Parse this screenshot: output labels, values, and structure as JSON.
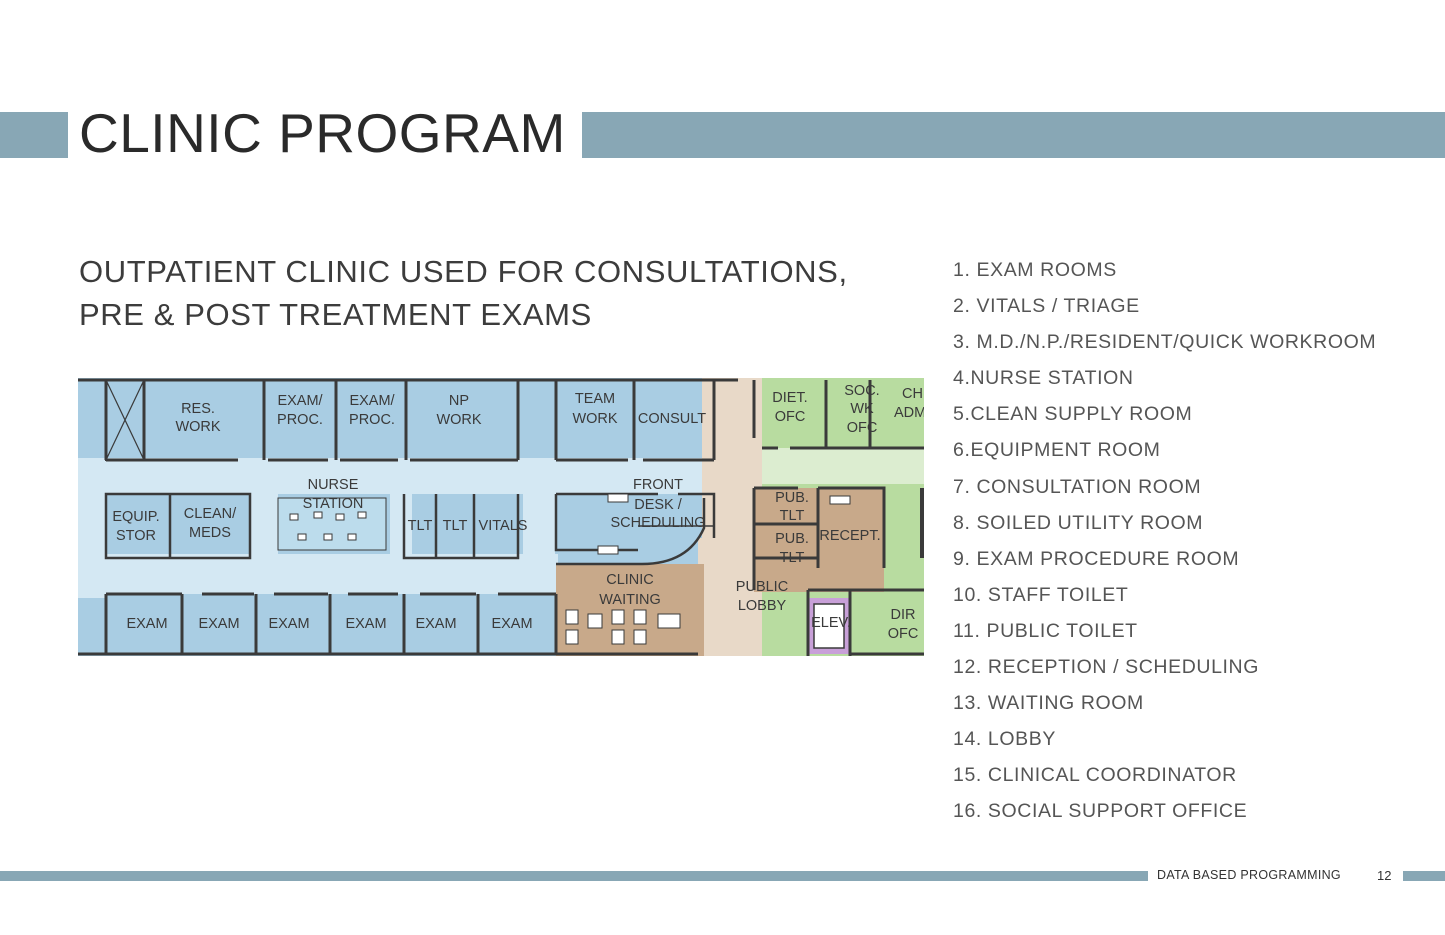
{
  "header": {
    "title": "CLINIC PROGRAM"
  },
  "intro": {
    "line1": "OUTPATIENT CLINIC USED FOR CONSULTATIONS,",
    "line2": "PRE & POST TREATMENT EXAMS"
  },
  "program_list": [
    "1. EXAM ROOMS",
    "2. VITALS / TRIAGE",
    "3. M.D./N.P./RESIDENT/QUICK WORKROOM",
    "4.NURSE STATION",
    "5.CLEAN SUPPLY ROOM",
    "6.EQUIPMENT ROOM",
    "7. CONSULTATION ROOM",
    "8. SOILED UTILITY ROOM",
    "9. EXAM PROCEDURE ROOM",
    "10. STAFF TOILET",
    "11. PUBLIC TOILET",
    "12. RECEPTION / SCHEDULING",
    "13. WAITING ROOM",
    "14. LOBBY",
    "15. CLINICAL COORDINATOR",
    "16. SOCIAL SUPPORT OFFICE"
  ],
  "floor_plan": {
    "colors": {
      "clinic_blue": "#a9cde3",
      "corridor_blue": "#d4e8f3",
      "waiting_tan": "#c8a98a",
      "lobby_beige": "#e8d9c8",
      "office_green": "#b8dca0",
      "elevator_purple": "#c8a0d8",
      "wall": "#3a3a3a"
    },
    "rooms": {
      "res_work": [
        "RES.",
        "WORK"
      ],
      "exam_proc_1": [
        "EXAM/",
        "PROC."
      ],
      "exam_proc_2": [
        "EXAM/",
        "PROC."
      ],
      "np_work": [
        "NP",
        "WORK"
      ],
      "team_work": [
        "TEAM",
        "WORK"
      ],
      "consult": "CONSULT",
      "diet_ofc": [
        "DIET.",
        "OFC"
      ],
      "soc_wk_ofc": [
        "SOC.",
        "WK",
        "OFC"
      ],
      "chi_adm": [
        "CHI",
        "ADM"
      ],
      "nurse_station": [
        "NURSE",
        "STATION"
      ],
      "equip_stor": [
        "EQUIP.",
        "STOR"
      ],
      "clean_meds": [
        "CLEAN/",
        "MEDS"
      ],
      "tlt_1": "TLT",
      "tlt_2": "TLT",
      "vitals": "VITALS",
      "front_desk": [
        "FRONT",
        "DESK /",
        "SCHEDULING"
      ],
      "pub_tlt_1": [
        "PUB.",
        "TLT"
      ],
      "pub_tlt_2": [
        "PUB.",
        "TLT"
      ],
      "recept": "RECEPT.",
      "clinic_waiting": [
        "CLINIC",
        "WAITING"
      ],
      "public_lobby": [
        "PUBLIC",
        "LOBBY"
      ],
      "elev": "ELEV.",
      "dir_ofc": [
        "DIR",
        "OFC"
      ],
      "exam": "EXAM"
    }
  },
  "footer": {
    "label": "DATA BASED PROGRAMMING",
    "page_number": "12"
  }
}
